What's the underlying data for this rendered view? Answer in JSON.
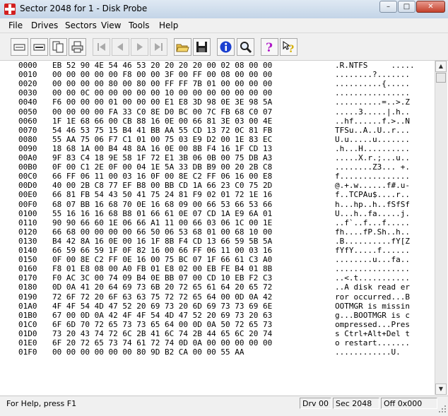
{
  "window": {
    "title": "Sector 2048 for 1 - Disk Probe",
    "minimize": "–",
    "maximize": "□",
    "close": "✕"
  },
  "menu": [
    "File",
    "Drives",
    "Sectors",
    "View",
    "Tools",
    "Help"
  ],
  "toolbar": [
    "read-icon",
    "write-icon",
    "copy-icon",
    "print-icon",
    "first-sector-icon",
    "prev-sector-icon",
    "next-sector-icon",
    "last-sector-icon",
    "open-icon",
    "save-icon",
    "info-icon",
    "find-icon",
    "help-icon",
    "context-help-icon"
  ],
  "rows": [
    {
      "a": "0000",
      "h": "EB 52 90 4E 54 46 53 20 20 20 20 00 02 08 00 00",
      "t": ".R.NTFS     ....."
    },
    {
      "a": "0010",
      "h": "00 00 00 00 00 F8 00 00 3F 00 FF 00 08 00 00 00",
      "t": "........?......."
    },
    {
      "a": "0020",
      "h": "00 00 00 00 80 00 80 00 FF FF 7B 01 00 00 00 00",
      "t": "..........{....."
    },
    {
      "a": "0030",
      "h": "00 00 0C 00 00 00 00 00 10 00 00 00 00 00 00 00",
      "t": "................"
    },
    {
      "a": "0040",
      "h": "F6 00 00 00 01 00 00 00 E1 E8 3D 98 0E 3E 98 5A",
      "t": "..........=..>.Z"
    },
    {
      "a": "0050",
      "h": "00 00 00 00 FA 33 C0 8E D0 BC 00 7C FB 68 C0 07",
      "t": ".....3.....|.h.."
    },
    {
      "a": "0060",
      "h": "1F 1E 68 66 00 CB 88 16 0E 00 66 81 3E 03 00 4E",
      "t": "..hf......f.>..N"
    },
    {
      "a": "0070",
      "h": "54 46 53 75 15 B4 41 BB AA 55 CD 13 72 0C 81 FB",
      "t": "TFSu..A..U..r..."
    },
    {
      "a": "0080",
      "h": "55 AA 75 06 F7 C1 01 00 75 03 E9 D2 00 1E 83 EC",
      "t": "U.u.....u......."
    },
    {
      "a": "0090",
      "h": "18 68 1A 00 B4 48 8A 16 0E 00 8B F4 16 1F CD 13",
      "t": ".h...H.........."
    },
    {
      "a": "00A0",
      "h": "9F 83 C4 18 9E 58 1F 72 E1 3B 06 0B 00 75 DB A3",
      "t": ".....X.r.;...u.."
    },
    {
      "a": "00B0",
      "h": "0F 00 C1 2E 0F 00 04 1E 5A 33 DB B9 00 20 2B C8",
      "t": "........Z3... +."
    },
    {
      "a": "00C0",
      "h": "66 FF 06 11 00 03 16 0F 00 8E C2 FF 06 16 00 E8",
      "t": "f..............."
    },
    {
      "a": "00D0",
      "h": "40 00 2B C8 77 EF B8 00 BB CD 1A 66 23 C0 75 2D",
      "t": "@.+.w......f#.u-"
    },
    {
      "a": "00E0",
      "h": "66 81 FB 54 43 50 41 75 24 81 F9 02 01 72 1E 16",
      "t": "f..TCPAu$....r.."
    },
    {
      "a": "00F0",
      "h": "68 07 BB 16 68 70 0E 16 68 09 00 66 53 66 53 66",
      "t": "h...hp..h..fSfSf"
    },
    {
      "a": "0100",
      "h": "55 16 16 16 68 B8 01 66 61 0E 07 CD 1A E9 6A 01",
      "t": "U...h..fa.....j."
    },
    {
      "a": "0110",
      "h": "90 90 66 60 1E 06 66 A1 11 00 66 03 06 1C 00 1E",
      "t": "..f`..f...f....."
    },
    {
      "a": "0120",
      "h": "66 68 00 00 00 00 66 50 06 53 68 01 00 68 10 00",
      "t": "fh....fP.Sh..h.."
    },
    {
      "a": "0130",
      "h": "B4 42 8A 16 0E 00 16 1F 8B F4 CD 13 66 59 5B 5A",
      "t": ".B..........fY[Z"
    },
    {
      "a": "0140",
      "h": "66 59 66 59 1F 0F 82 16 00 66 FF 06 11 00 03 16",
      "t": "fYfY.....f......"
    },
    {
      "a": "0150",
      "h": "0F 00 8E C2 FF 0E 16 00 75 BC 07 1F 66 61 C3 A0",
      "t": "........u...fa.."
    },
    {
      "a": "0160",
      "h": "F8 01 E8 08 00 A0 FB 01 E8 02 00 EB FE B4 01 8B",
      "t": "................"
    },
    {
      "a": "0170",
      "h": "F0 AC 3C 00 74 09 B4 0E BB 07 00 CD 10 EB F2 C3",
      "t": "..<.t..........."
    },
    {
      "a": "0180",
      "h": "0D 0A 41 20 64 69 73 6B 20 72 65 61 64 20 65 72",
      "t": "..A disk read er"
    },
    {
      "a": "0190",
      "h": "72 6F 72 20 6F 63 63 75 72 72 65 64 00 0D 0A 42",
      "t": "ror occurred...B"
    },
    {
      "a": "01A0",
      "h": "4F 4F 54 4D 47 52 20 69 73 20 6D 69 73 73 69 6E",
      "t": "OOTMGR is missin"
    },
    {
      "a": "01B0",
      "h": "67 00 0D 0A 42 4F 4F 54 4D 47 52 20 69 73 20 63",
      "t": "g...BOOTMGR is c"
    },
    {
      "a": "01C0",
      "h": "6F 6D 70 72 65 73 73 65 64 00 0D 0A 50 72 65 73",
      "t": "ompressed...Pres"
    },
    {
      "a": "01D0",
      "h": "73 20 43 74 72 6C 2B 41 6C 74 2B 44 65 6C 20 74",
      "t": "s Ctrl+Alt+Del t"
    },
    {
      "a": "01E0",
      "h": "6F 20 72 65 73 74 61 72 74 0D 0A 00 00 00 00 00",
      "t": "o restart......."
    },
    {
      "a": "01F0",
      "h": "00 00 00 00 00 00 80 9D B2 CA 00 00 55 AA",
      "t": "............U."
    }
  ],
  "status": {
    "help": "For Help, press F1",
    "drive": "Drv 00",
    "sector": "Sec 2048",
    "offset": "Off 0x000"
  }
}
